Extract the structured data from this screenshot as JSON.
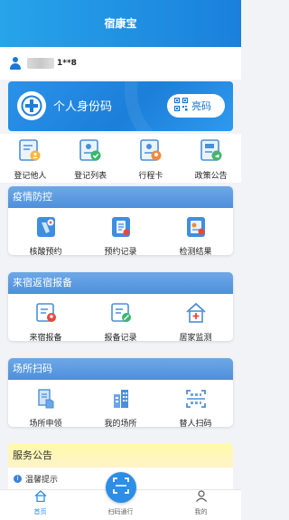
{
  "header": {
    "title": "宿康宝"
  },
  "user": {
    "masked_name": "1**8"
  },
  "id_card": {
    "title": "个人身份码",
    "button_label": "亮码"
  },
  "quick_actions": [
    {
      "label": "登记他人",
      "icon": "register-other-icon"
    },
    {
      "label": "登记列表",
      "icon": "register-list-icon"
    },
    {
      "label": "行程卡",
      "icon": "trip-card-icon"
    },
    {
      "label": "政策公告",
      "icon": "policy-notice-icon"
    }
  ],
  "epidemic": {
    "title": "疫情防控",
    "items": [
      {
        "label": "核酸预约",
        "icon": "nucleic-reservation-icon"
      },
      {
        "label": "预约记录",
        "icon": "reservation-record-icon"
      },
      {
        "label": "检测结果",
        "icon": "test-result-icon"
      }
    ]
  },
  "return_report": {
    "title": "来宿返宿报备",
    "items": [
      {
        "label": "来宿报备",
        "icon": "arrival-report-icon"
      },
      {
        "label": "报备记录",
        "icon": "report-record-icon"
      },
      {
        "label": "居家监测",
        "icon": "home-monitor-icon"
      }
    ]
  },
  "venue_scan": {
    "title": "场所扫码",
    "items": [
      {
        "label": "场所申领",
        "icon": "venue-apply-icon"
      },
      {
        "label": "我的场所",
        "icon": "my-venue-icon"
      },
      {
        "label": "替人扫码",
        "icon": "scan-for-others-icon"
      }
    ]
  },
  "notice": {
    "title": "服务公告",
    "item": "温馨提示"
  },
  "tabbar": {
    "home": "首页",
    "scan": "扫码通行",
    "mine": "我的"
  },
  "colors": {
    "primary": "#1a80dc",
    "header_gradient_start": "#27a4ea",
    "panel_header": "#4e8fdc",
    "notice_header": "#fffaa8"
  }
}
